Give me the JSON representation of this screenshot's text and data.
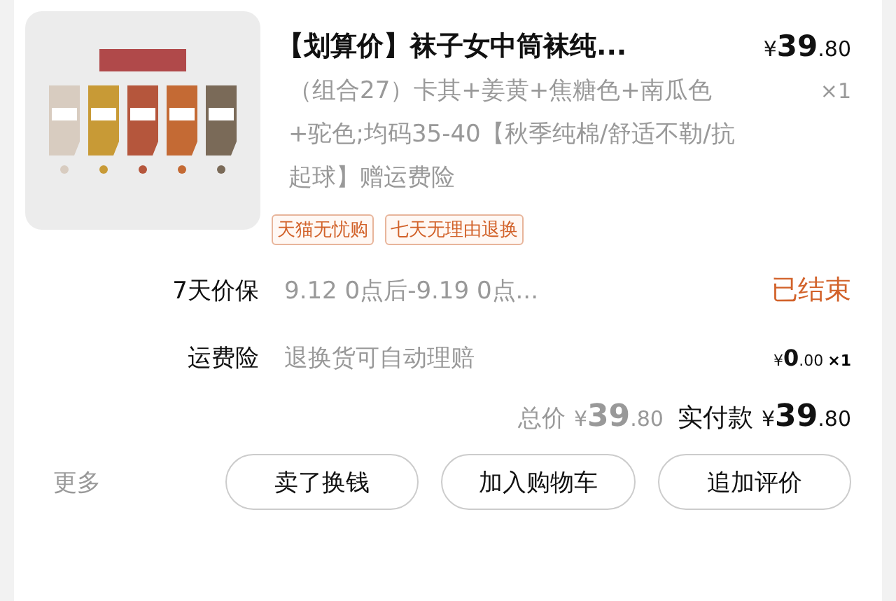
{
  "item": {
    "title": "【划算价】袜子女中筒袜纯...",
    "price": {
      "currency": "¥",
      "integer": "39",
      "decimal": ".80"
    },
    "quantity": "×1",
    "sku": "（组合27）卡其+姜黄+焦糖色+南瓜色+驼色;均码35-40【秋季纯棉/舒适不勒/抗起球】赠运费险",
    "tags": [
      "天猫无忧购",
      "七天无理由退换"
    ]
  },
  "services": [
    {
      "kind": "status",
      "label": "7天价保",
      "detail": "9.12 0点后-9.19 0点...",
      "status": "已结束"
    },
    {
      "kind": "price",
      "label": "运费险",
      "detail": "退换货可自动理赔",
      "price": {
        "currency": "¥",
        "integer": "0",
        "decimal": ".00"
      },
      "quantity": "×1"
    }
  ],
  "totals": {
    "total_label": "总价",
    "total": {
      "currency": "¥",
      "integer": "39",
      "decimal": ".80"
    },
    "paid_label": "实付款",
    "paid": {
      "currency": "¥",
      "integer": "39",
      "decimal": ".80"
    }
  },
  "actions": {
    "more": "更多",
    "buttons": [
      "卖了换钱",
      "加入购物车",
      "追加评价"
    ]
  }
}
